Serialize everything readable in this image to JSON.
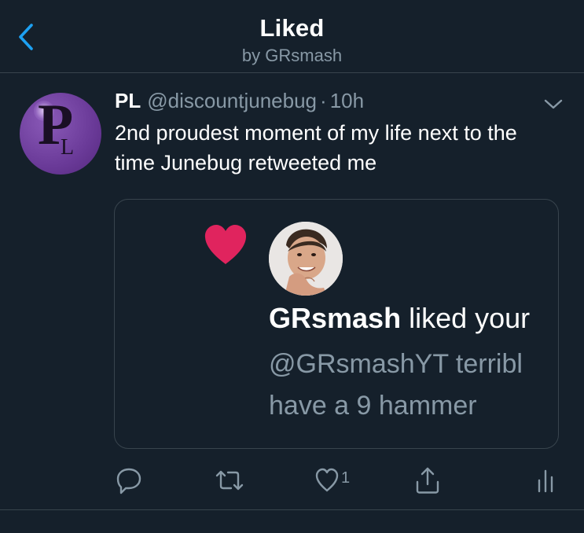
{
  "header": {
    "title": "Liked",
    "subtitle": "by GRsmash"
  },
  "tweet": {
    "display_name": "PL",
    "handle": "@discountjunebug",
    "separator": "·",
    "time": "10h",
    "text": "2nd proudest moment of my life next to the time Junebug retweeted me",
    "avatar_letters": {
      "big": "P",
      "small": "L"
    },
    "media": {
      "notification_name": "GRsmash",
      "notification_action": "liked your",
      "quoted_line1": "@GRsmashYT terribl",
      "quoted_line2": "have a 9 hammer"
    },
    "like_count": "1"
  },
  "icons": {
    "back": "chevron-left-icon",
    "caret": "chevron-down-icon",
    "reply": "reply-icon",
    "retweet": "retweet-icon",
    "like": "heart-icon",
    "share": "share-icon",
    "analytics": "analytics-icon",
    "notification_heart": "heart-filled-icon"
  },
  "colors": {
    "background": "#15202b",
    "accent": "#1da1f2",
    "secondary_text": "#8899a6",
    "divider": "#38444d",
    "heart": "#e0245e",
    "avatar_purple": "#6a3a98"
  }
}
